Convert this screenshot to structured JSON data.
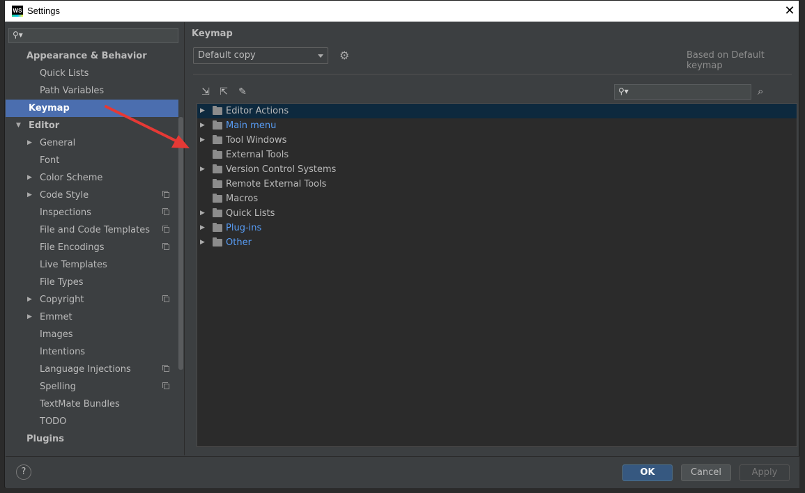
{
  "window": {
    "title": "Settings",
    "logo_text": "WS",
    "close_glyph": "✕"
  },
  "sidebar": {
    "search_placeholder": "",
    "items": [
      {
        "label": "Appearance & Behavior",
        "level": 0,
        "bold": true
      },
      {
        "label": "Quick Lists",
        "level": 1
      },
      {
        "label": "Path Variables",
        "level": 1
      },
      {
        "label": "Keymap",
        "level": 0,
        "bold": true,
        "selected": true
      },
      {
        "label": "Editor",
        "level": 0,
        "bold": true,
        "expanded": true
      },
      {
        "label": "General",
        "level": 1,
        "collapsed": true
      },
      {
        "label": "Font",
        "level": 1
      },
      {
        "label": "Color Scheme",
        "level": 1,
        "collapsed": true
      },
      {
        "label": "Code Style",
        "level": 1,
        "collapsed": true,
        "copy": true
      },
      {
        "label": "Inspections",
        "level": 1,
        "copy": true
      },
      {
        "label": "File and Code Templates",
        "level": 1,
        "copy": true
      },
      {
        "label": "File Encodings",
        "level": 1,
        "copy": true
      },
      {
        "label": "Live Templates",
        "level": 1
      },
      {
        "label": "File Types",
        "level": 1
      },
      {
        "label": "Copyright",
        "level": 1,
        "collapsed": true,
        "copy": true
      },
      {
        "label": "Emmet",
        "level": 1,
        "collapsed": true
      },
      {
        "label": "Images",
        "level": 1
      },
      {
        "label": "Intentions",
        "level": 1
      },
      {
        "label": "Language Injections",
        "level": 1,
        "copy": true
      },
      {
        "label": "Spelling",
        "level": 1,
        "copy": true
      },
      {
        "label": "TextMate Bundles",
        "level": 1
      },
      {
        "label": "TODO",
        "level": 1
      },
      {
        "label": "Plugins",
        "level": 0,
        "bold": true
      }
    ]
  },
  "main": {
    "title": "Keymap",
    "keymap_select": {
      "value": "Default copy"
    },
    "based_on": "Based on Default keymap",
    "tree_search_placeholder": "",
    "toolbar_icons": [
      "expand-all-icon",
      "collapse-all-icon",
      "edit-icon"
    ],
    "actions": [
      {
        "label": "Editor Actions",
        "expandable": true,
        "selected": true,
        "link": false
      },
      {
        "label": "Main menu",
        "expandable": true,
        "link": true
      },
      {
        "label": "Tool Windows",
        "expandable": true,
        "link": false
      },
      {
        "label": "External Tools",
        "expandable": false,
        "link": false
      },
      {
        "label": "Version Control Systems",
        "expandable": true,
        "link": false
      },
      {
        "label": "Remote External Tools",
        "expandable": false,
        "link": false
      },
      {
        "label": "Macros",
        "expandable": false,
        "link": false
      },
      {
        "label": "Quick Lists",
        "expandable": true,
        "link": false
      },
      {
        "label": "Plug-ins",
        "expandable": true,
        "link": true
      },
      {
        "label": "Other",
        "expandable": true,
        "link": true
      }
    ]
  },
  "buttons": {
    "help": "?",
    "ok": "OK",
    "cancel": "Cancel",
    "apply": "Apply"
  },
  "colors": {
    "selection": "#4b6eaf",
    "link": "#589df6",
    "ok_button": "#365880",
    "annotation_arrow": "#e53935"
  }
}
